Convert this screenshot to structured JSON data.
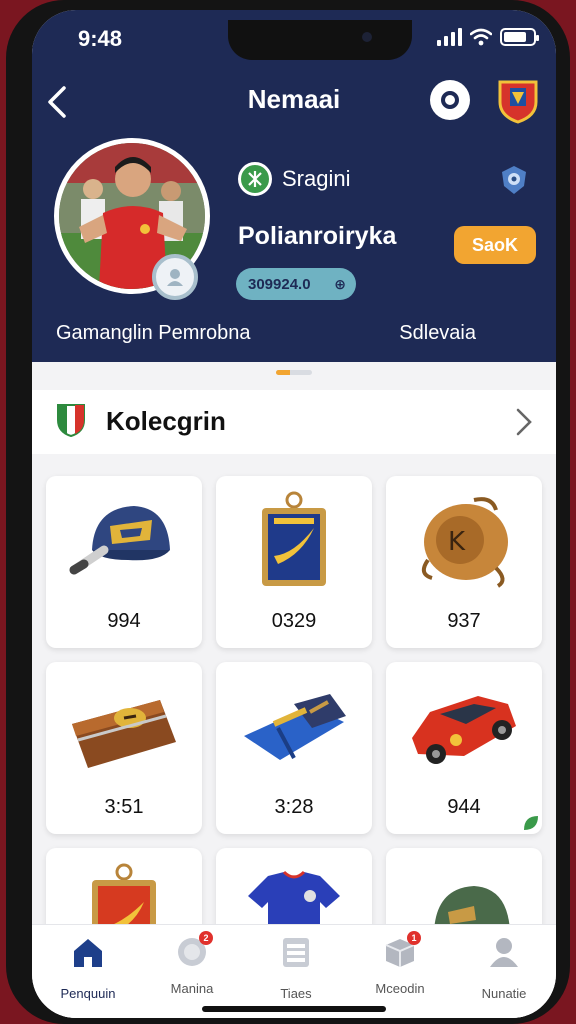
{
  "status_bar": {
    "time": "9:48"
  },
  "header": {
    "title": "Nemaai",
    "club_name": "Sragini",
    "username": "Polianroiryka",
    "action_button": "SaoK",
    "player_id": "309924.0",
    "meta_left": "Gamanglin Pemrobna",
    "meta_right": "Sdlevaia"
  },
  "section": {
    "title": "Kolecgrin"
  },
  "collection": {
    "items": [
      {
        "icon": "cap-icon",
        "value": "994"
      },
      {
        "icon": "medal-icon",
        "value": "0329"
      },
      {
        "icon": "pouch-icon",
        "value": "937"
      },
      {
        "icon": "wallet-icon",
        "value": "3:51"
      },
      {
        "icon": "scarf-icon",
        "value": "3:28"
      },
      {
        "icon": "car-icon",
        "value": "944"
      },
      {
        "icon": "medal-icon",
        "value": ""
      },
      {
        "icon": "jersey-icon",
        "value": ""
      },
      {
        "icon": "cap-icon",
        "value": ""
      }
    ]
  },
  "tabbar": {
    "tabs": [
      {
        "label": "Penquuin",
        "icon": "home-icon"
      },
      {
        "label": "Manina",
        "icon": "ball-icon"
      },
      {
        "label": "Tiaes",
        "icon": "list-icon"
      },
      {
        "label": "Mceodin",
        "icon": "box-icon"
      },
      {
        "label": "Nunatie",
        "icon": "profile-icon"
      }
    ]
  },
  "colors": {
    "header": "#1e2a55",
    "accent": "#f2a531",
    "pill": "#6fb2c2",
    "badge": "#e0312c"
  }
}
